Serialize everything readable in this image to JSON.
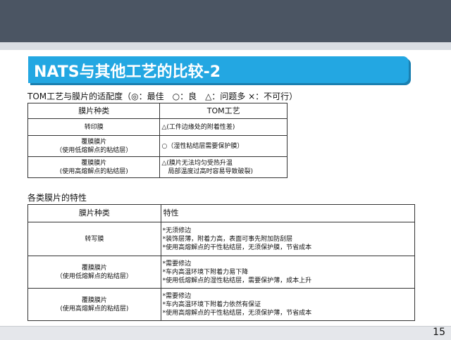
{
  "slide": {
    "title": "NATS与其他工艺的比较-2",
    "page_number": "15"
  },
  "table1": {
    "caption": "TOM工艺与膜片的适配度（◎：最佳　○：良　△：问题多 ×：不可行）",
    "headers": [
      "膜片种类",
      "TOM工艺"
    ],
    "rows": [
      {
        "type": [
          "转印膜"
        ],
        "value": [
          "△(工件边缘处的附着性差)"
        ]
      },
      {
        "type": [
          "覆膜膜片",
          "（使用低熔解点的粘结层）"
        ],
        "value": [
          "○（湿性粘结层需要保护膜）"
        ]
      },
      {
        "type": [
          "覆膜膜片",
          "(使用高熔解点的粘结层)"
        ],
        "value": [
          "△(膜片无法均匀受热升温",
          "　局部温度过高时容易导致破裂)"
        ]
      }
    ]
  },
  "table2": {
    "caption": "各类膜片的特性",
    "headers": [
      "膜片种类",
      "特性"
    ],
    "rows": [
      {
        "type": [
          "转写膜"
        ],
        "value": [
          "*无须修边",
          "*装饰层薄，附着力高，表面可事先附加防刮层",
          "*使用高熔解点的干性粘结层，无须保护膜，节省成本"
        ]
      },
      {
        "type": [
          "覆膜膜片",
          "（使用低熔解点的粘结层）"
        ],
        "value": [
          "*需要修边",
          "*车内高温环境下附着力易下降",
          "*使用低熔解点的湿性粘结层，需要保护薄，成本上升"
        ]
      },
      {
        "type": [
          "覆膜膜片",
          "(使用高熔解点的粘结层)"
        ],
        "value": [
          "*需要修边",
          "*车内高温环境下附着力依然有保证",
          "*使用高熔解点的干性粘结层，无须保护薄，节省成本"
        ]
      }
    ]
  }
}
